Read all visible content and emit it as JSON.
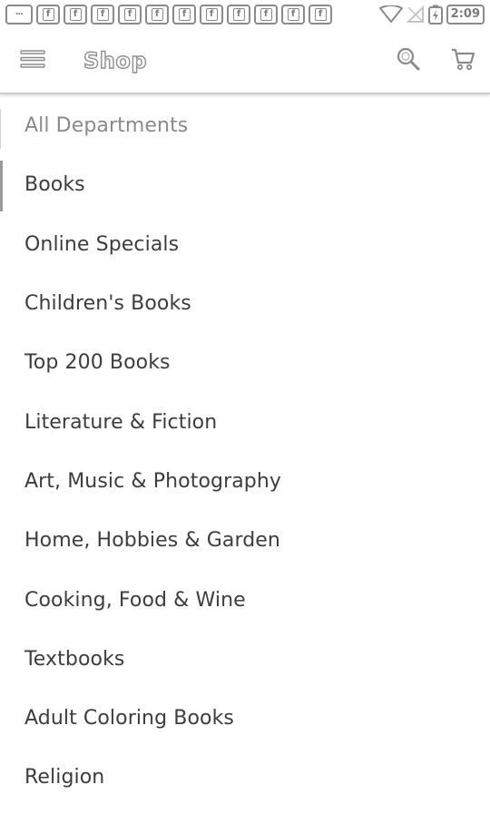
{
  "status_bar": {
    "time": "2:09",
    "notification_count": 11,
    "notification_icon": "facebook-icon"
  },
  "app_bar": {
    "title": "Shop",
    "menu_icon": "menu-icon",
    "search_icon": "search-icon",
    "cart_icon": "cart-icon"
  },
  "departments": {
    "header": "All Departments",
    "selected": "Books",
    "items": [
      "Books",
      "Online Specials",
      "Children's Books",
      "Top 200 Books",
      "Literature & Fiction",
      "Art, Music & Photography",
      "Home, Hobbies & Garden",
      "Cooking, Food & Wine",
      "Textbooks",
      "Adult Coloring Books",
      "Religion"
    ]
  },
  "colors": {
    "text": "#3d3d3d",
    "muted_text": "#8a8a8a",
    "divider": "#cfcfcf",
    "background": "#ffffff"
  }
}
